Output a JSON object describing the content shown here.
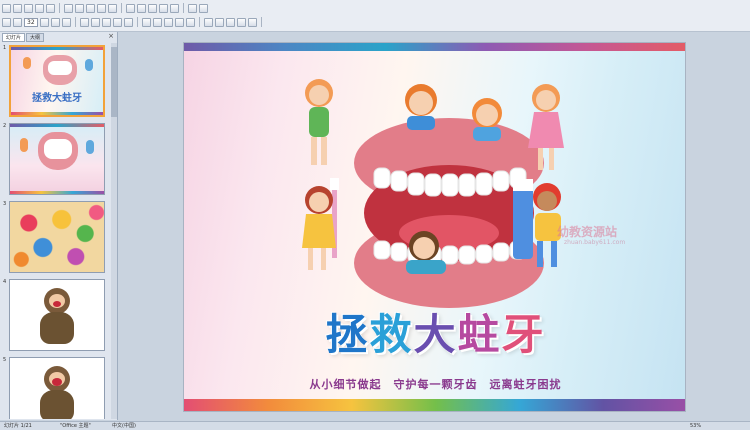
{
  "toolbar": {
    "font_size": "32",
    "row1_buttons": [
      "new",
      "open",
      "save",
      "print",
      "preview",
      "spell",
      "cut",
      "copy",
      "paste",
      "format-painter",
      "undo",
      "redo",
      "insert-table",
      "insert-chart",
      "insert-picture",
      "hyperlink",
      "zoom"
    ],
    "row2_buttons": [
      "font-size-up",
      "font-size-down",
      "bold",
      "italic",
      "underline",
      "shadow",
      "align-left",
      "center",
      "align-right",
      "bullets",
      "numbering",
      "indent",
      "outdent",
      "text-direction",
      "font-color",
      "shapes",
      "arrange",
      "quick-styles",
      "fill",
      "outline"
    ]
  },
  "sidebar": {
    "tabs": [
      "幻灯片",
      "大纲"
    ],
    "close_icon": "close-icon",
    "slides": [
      {
        "num": "1",
        "kind": "title"
      },
      {
        "num": "2",
        "kind": "mouth"
      },
      {
        "num": "3",
        "kind": "candy"
      },
      {
        "num": "4",
        "kind": "crying-child"
      },
      {
        "num": "5",
        "kind": "crying-child"
      }
    ]
  },
  "slide": {
    "title": "拯救大蛀牙",
    "title_chars": [
      "拯",
      "救",
      "大",
      "蛀",
      "牙"
    ],
    "subtitle": "从小细节做起　守护每一颗牙齿　远离蛀牙困扰",
    "watermark": "幼教资源站",
    "watermark_url": "zhuan.baby611.com",
    "thumb_title": "拯救大蛀牙"
  },
  "statusbar": {
    "slide_index": "幻灯片 1/21",
    "theme": "\"Office 主题\"",
    "language": "中文(中国)",
    "zoom": "53%"
  },
  "colors": {
    "accent_blue": "#1f76c9",
    "accent_purple": "#6a4fb0",
    "accent_pink": "#e0507a",
    "selection": "#f2a23a"
  }
}
